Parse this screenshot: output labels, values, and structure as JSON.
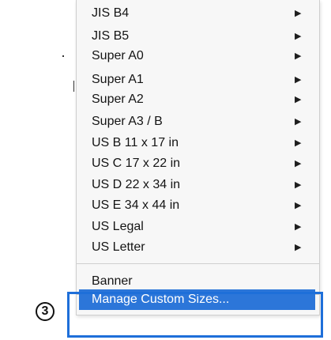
{
  "menu": {
    "items": [
      {
        "label": "JIS B4",
        "submenu": true
      },
      {
        "label": "JIS B5",
        "submenu": true
      },
      {
        "label": "Super A0",
        "submenu": true
      },
      {
        "label": "Super A1",
        "submenu": true
      },
      {
        "label": "Super A2",
        "submenu": true
      },
      {
        "label": "Super A3 / B",
        "submenu": true
      },
      {
        "label": "US B 11 x 17 in",
        "submenu": true
      },
      {
        "label": "US C 17 x 22 in",
        "submenu": true
      },
      {
        "label": "US D 22 x 34 in",
        "submenu": true
      },
      {
        "label": "US E 34 x 44 in",
        "submenu": true
      },
      {
        "label": "US Legal",
        "submenu": true
      },
      {
        "label": "US Letter",
        "submenu": true
      }
    ],
    "arrow_glyph": "▶",
    "banner_label": "Banner",
    "manage_label": "Manage Custom Sizes..."
  },
  "callout": {
    "step_number": "3",
    "color": "#1e6fd9"
  },
  "colors": {
    "highlight": "#2c76d9",
    "menu_bg": "#f7f7f7"
  }
}
